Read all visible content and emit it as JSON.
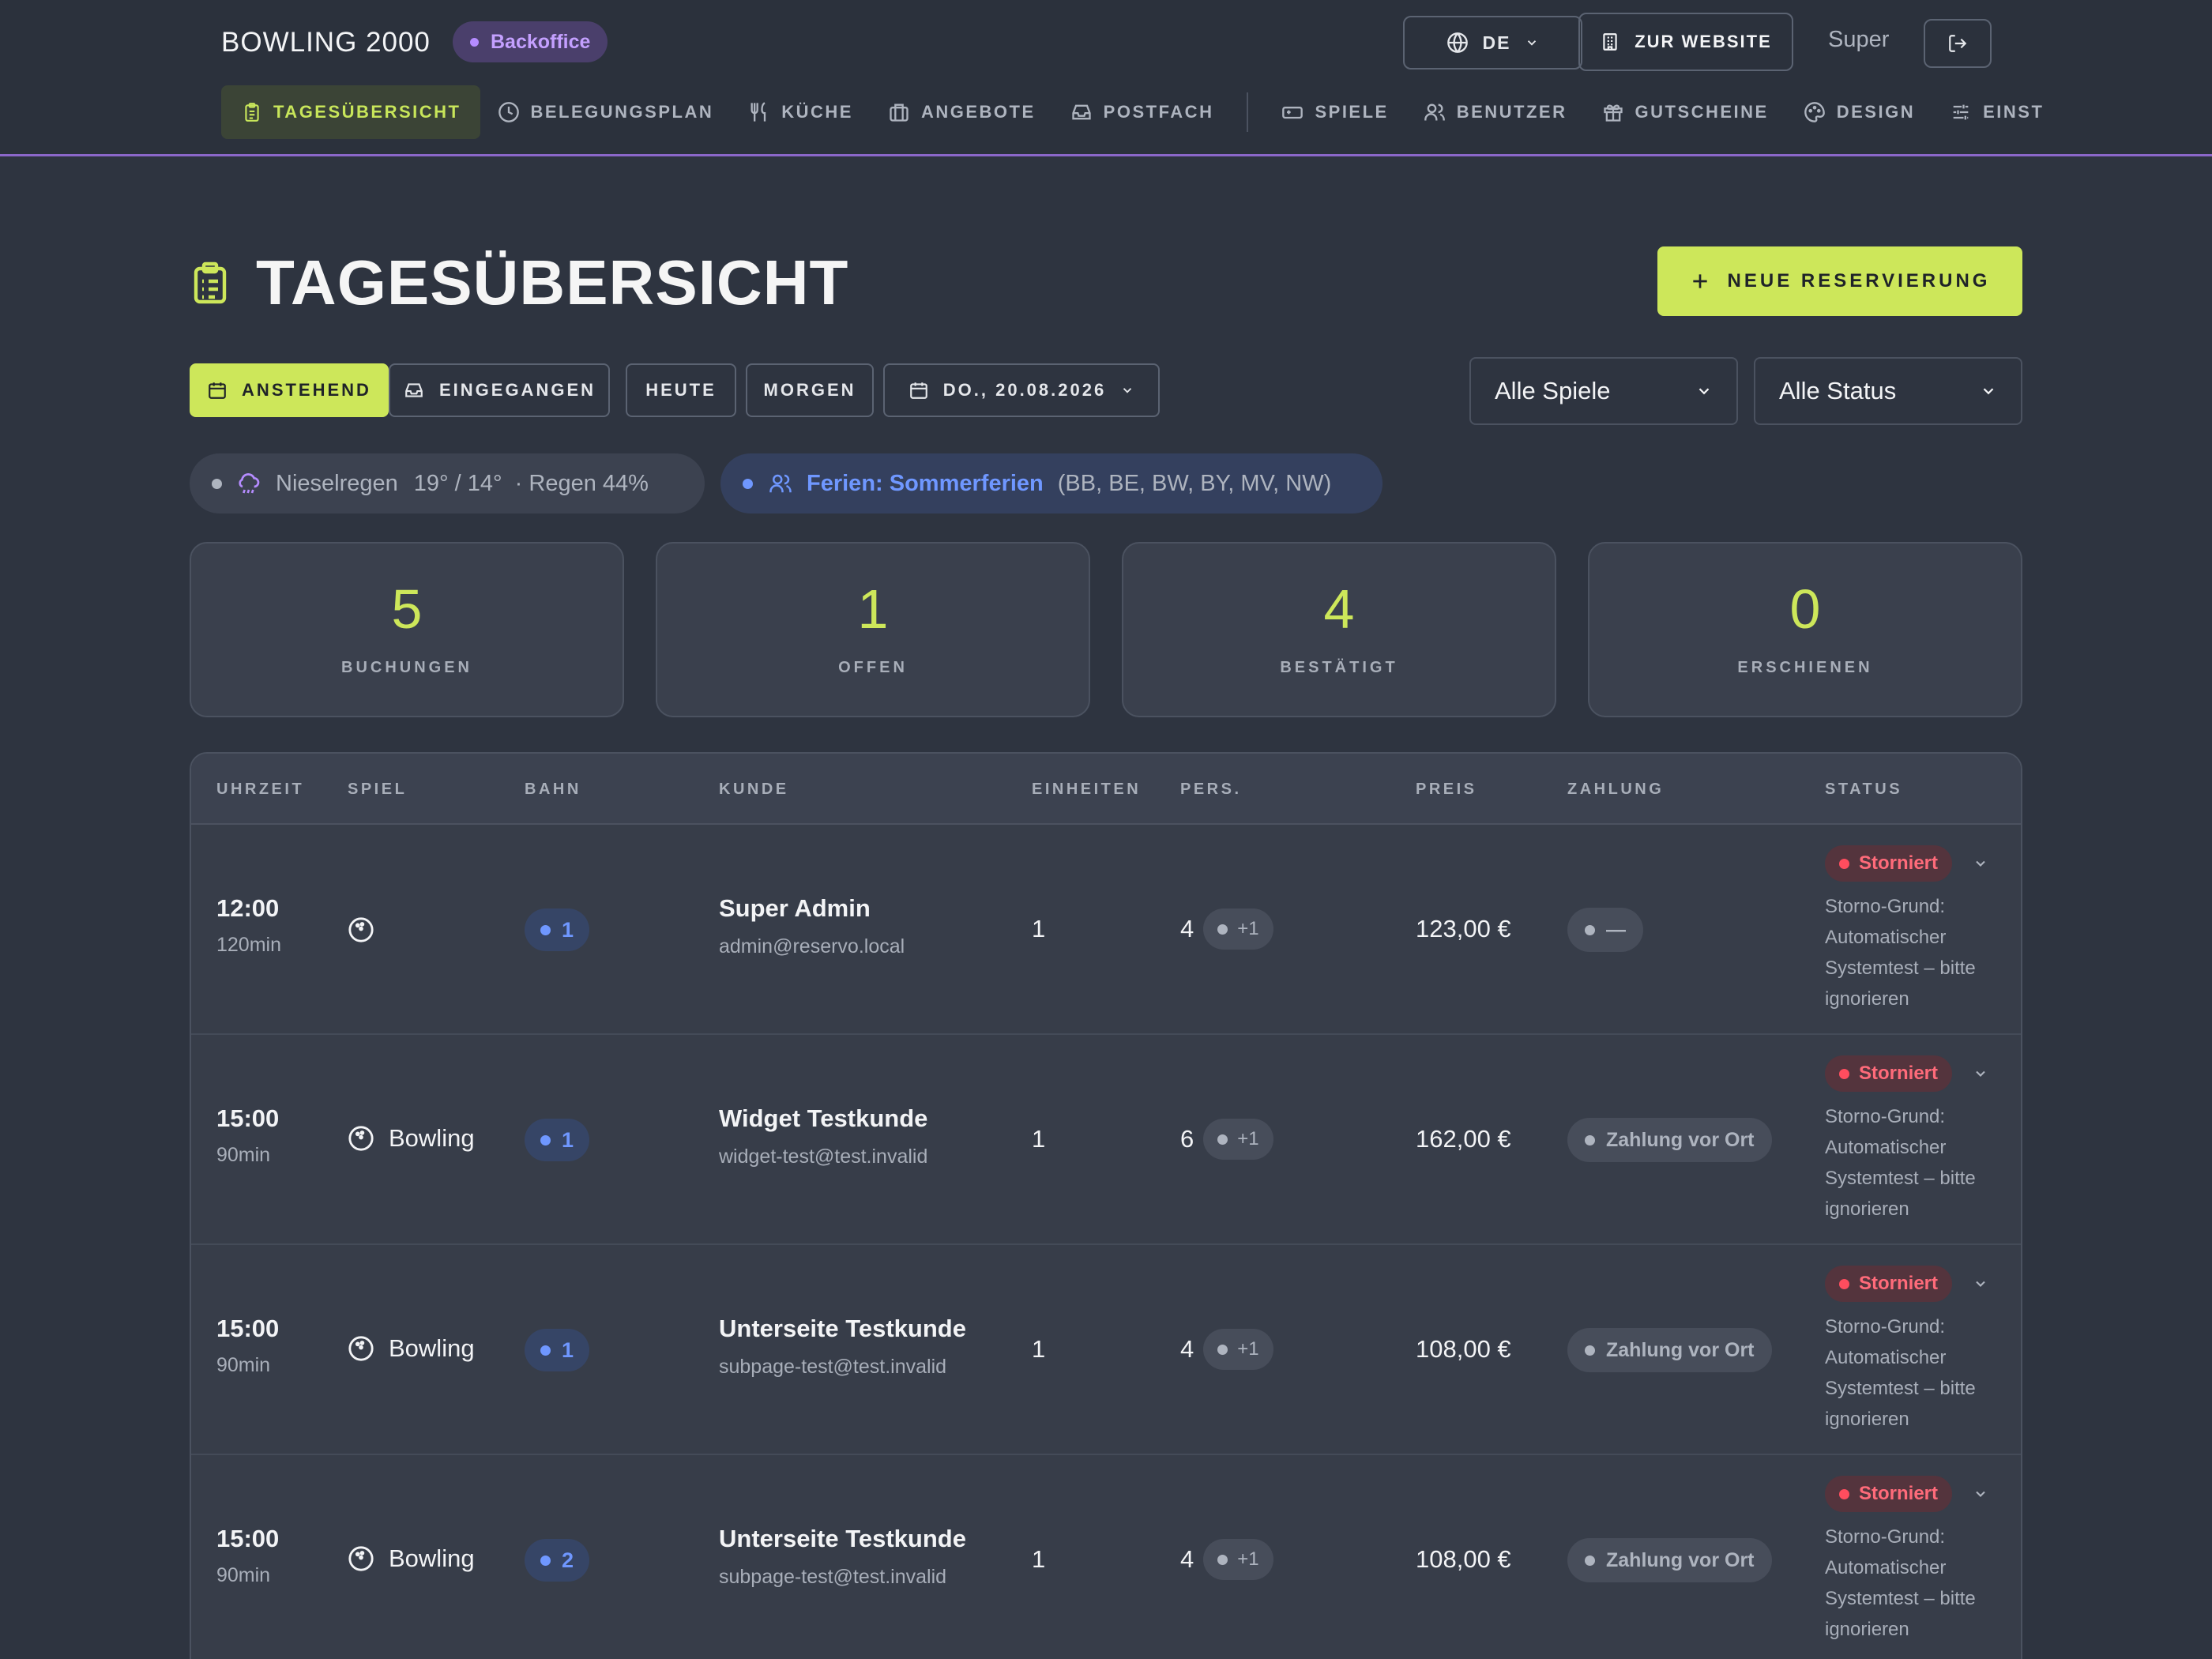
{
  "header": {
    "brand": "BOWLING 2000",
    "badge": "Backoffice",
    "lang": "DE",
    "website_button": "ZUR WEBSITE",
    "user": "Super"
  },
  "nav": {
    "items": [
      {
        "label": "TAGESÜBERSICHT",
        "icon": "clipboard-icon",
        "active": true
      },
      {
        "label": "BELEGUNGSPLAN",
        "icon": "clock-icon"
      },
      {
        "label": "KÜCHE",
        "icon": "utensils-icon"
      },
      {
        "label": "ANGEBOTE",
        "icon": "briefcase-icon"
      },
      {
        "label": "POSTFACH",
        "icon": "inbox-icon"
      },
      {
        "label": "SPIELE",
        "icon": "gamepad-icon"
      },
      {
        "label": "BENUTZER",
        "icon": "users-icon"
      },
      {
        "label": "GUTSCHEINE",
        "icon": "gift-icon"
      },
      {
        "label": "DESIGN",
        "icon": "palette-icon"
      },
      {
        "label": "EINST",
        "icon": "sliders-icon"
      }
    ]
  },
  "page": {
    "title": "TAGESÜBERSICHT",
    "new_button": "NEUE RESERVIERUNG"
  },
  "filters": {
    "upcoming": "ANSTEHEND",
    "received": "EINGEGANGEN",
    "today": "HEUTE",
    "tomorrow": "MORGEN",
    "date": "DO., 20.08.2026",
    "games_select": "Alle Spiele",
    "status_select": "Alle Status"
  },
  "weather": {
    "condition": "Nieselregen",
    "temps": "19° / 14°",
    "rain": "· Regen 44%"
  },
  "holiday": {
    "label": "Ferien: Sommerferien",
    "states": "(BB, BE, BW, BY, MV, NW)"
  },
  "stats": [
    {
      "value": "5",
      "label": "BUCHUNGEN"
    },
    {
      "value": "1",
      "label": "OFFEN"
    },
    {
      "value": "4",
      "label": "BESTÄTIGT"
    },
    {
      "value": "0",
      "label": "ERSCHIENEN"
    }
  ],
  "table": {
    "columns": [
      "UHRZEIT",
      "SPIEL",
      "BAHN",
      "KUNDE",
      "EINHEITEN",
      "PERS.",
      "PREIS",
      "ZAHLUNG",
      "STATUS"
    ],
    "rows": [
      {
        "time": "12:00",
        "duration": "120min",
        "game": "",
        "lane": "1",
        "customer": "Super Admin",
        "email": "admin@reservo.local",
        "units": "1",
        "persons": "4",
        "extra": "+1",
        "price": "123,00 €",
        "payment": "—",
        "status": "Storniert",
        "storno": "Storno-Grund: Automatischer Systemtest – bitte ignorieren"
      },
      {
        "time": "15:00",
        "duration": "90min",
        "game": "Bowling",
        "lane": "1",
        "customer": "Widget Testkunde",
        "email": "widget-test@test.invalid",
        "units": "1",
        "persons": "6",
        "extra": "+1",
        "price": "162,00 €",
        "payment": "Zahlung vor Ort",
        "status": "Storniert",
        "storno": "Storno-Grund: Automatischer Systemtest – bitte ignorieren"
      },
      {
        "time": "15:00",
        "duration": "90min",
        "game": "Bowling",
        "lane": "1",
        "customer": "Unterseite Testkunde",
        "email": "subpage-test@test.invalid",
        "units": "1",
        "persons": "4",
        "extra": "+1",
        "price": "108,00 €",
        "payment": "Zahlung vor Ort",
        "status": "Storniert",
        "storno": "Storno-Grund: Automatischer Systemtest – bitte ignorieren"
      },
      {
        "time": "15:00",
        "duration": "90min",
        "game": "Bowling",
        "lane": "2",
        "customer": "Unterseite Testkunde",
        "email": "subpage-test@test.invalid",
        "units": "1",
        "persons": "4",
        "extra": "+1",
        "price": "108,00 €",
        "payment": "Zahlung vor Ort",
        "status": "Storniert",
        "storno": "Storno-Grund: Automatischer Systemtest – bitte ignorieren"
      }
    ]
  },
  "colors": {
    "accent": "#cde75a",
    "purple": "#8b67c9",
    "blue": "#6f97ff",
    "cancelled": "#ff6b7a",
    "background": "#2e3440"
  }
}
